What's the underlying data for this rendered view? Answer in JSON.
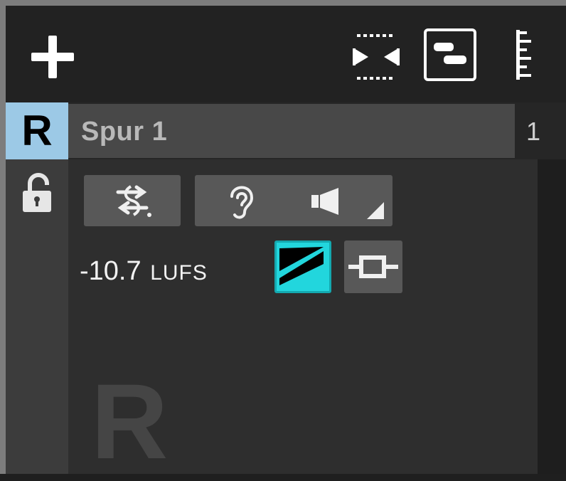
{
  "toolbar": {
    "add_icon": "plus-icon",
    "zoom_icon": "zoom-fit-icon",
    "overview_icon": "overview-icon",
    "ruler_icon": "ruler-icon"
  },
  "track": {
    "record_label": "R",
    "name": "Spur 1",
    "number": "1",
    "lock_icon": "unlocked-padlock-icon",
    "routing_icon": "routing-icon",
    "monitor_icon": "ear-icon",
    "speaker_icon": "speaker-icon",
    "loudness_value": "-10.7",
    "loudness_unit": "LUFS",
    "fx_icon": "fx-ramp-icon",
    "insert_icon": "insert-icon",
    "watermark": "R"
  },
  "colors": {
    "record_badge": "#9cc9e6",
    "fx_active": "#22d6dd",
    "panel": "#2e2e2e",
    "button": "#585858"
  }
}
